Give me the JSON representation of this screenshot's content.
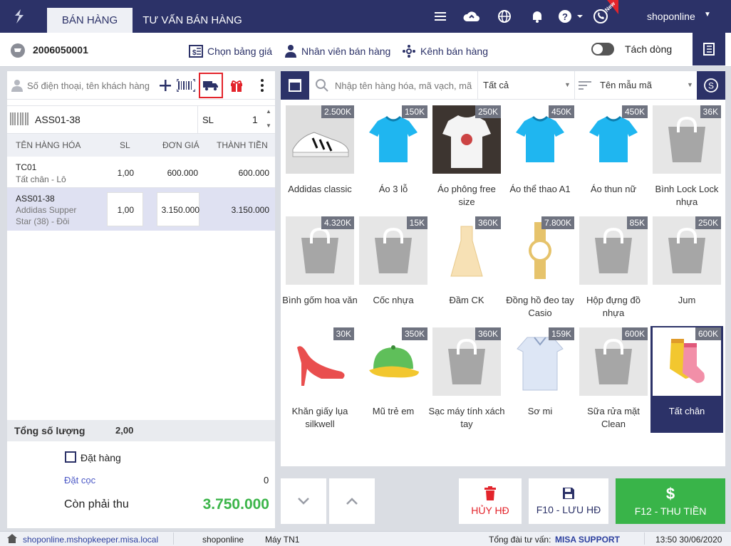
{
  "tabs": {
    "sales": "BÁN HÀNG",
    "consult": "TƯ VẤN BÁN HÀNG"
  },
  "topbar": {
    "user": "shoponline",
    "new_badge": "New"
  },
  "header": {
    "invoice_no": "2006050001",
    "price_list": "Chọn bảng giá",
    "staff": "Nhân viên bán hàng",
    "channel": "Kênh bán hàng",
    "split_line": "Tách dòng"
  },
  "customer": {
    "placeholder": "Số điện thoại, tên khách hàng"
  },
  "sku_input": {
    "value": "ASS01-38",
    "qty_label": "SL",
    "qty_value": "1"
  },
  "table": {
    "headers": {
      "name": "TÊN HÀNG HÓA",
      "qty": "SL",
      "price": "ĐƠN GIÁ",
      "total": "THÀNH TIỀN"
    },
    "rows": [
      {
        "code": "TC01",
        "desc": "Tất chân - Lô",
        "qty": "1,00",
        "price": "600.000",
        "total": "600.000"
      },
      {
        "code": "ASS01-38",
        "desc1": "Addidas Supper",
        "desc2": "Star (38) - Đôi",
        "qty": "1,00",
        "price": "3.150.000",
        "total": "3.150.000"
      }
    ]
  },
  "totals": {
    "label": "Tổng số lượng",
    "value": "2,00"
  },
  "summary": {
    "order_label": "Đặt hàng",
    "deposit_label": "Đặt cọc",
    "deposit_value": "0",
    "remaining_label": "Còn phải thu",
    "remaining_value": "3.750.000"
  },
  "search": {
    "placeholder": "Nhập tên hàng hóa, mã vạch, mã",
    "filter": "Tất cả",
    "template": "Tên mẫu mã"
  },
  "products": [
    {
      "name": "Addidas classic",
      "price": "2.500K",
      "img": "shoe"
    },
    {
      "name": "Áo 3 lỗ",
      "price": "150K",
      "img": "shirt"
    },
    {
      "name": "Áo phông free size",
      "price": "250K",
      "img": "tee"
    },
    {
      "name": "Áo thể thao A1",
      "price": "450K",
      "img": "shirt"
    },
    {
      "name": "Áo thun nữ",
      "price": "450K",
      "img": "shirt"
    },
    {
      "name": "Bình Lock Lock nhựa",
      "price": "36K",
      "img": "bag"
    },
    {
      "name": "Bình gốm hoa văn",
      "price": "4.320K",
      "img": "bag"
    },
    {
      "name": "Cốc nhựa",
      "price": "15K",
      "img": "bag"
    },
    {
      "name": "Đầm CK",
      "price": "360K",
      "img": "dress"
    },
    {
      "name": "Đồng hồ đeo tay Casio",
      "price": "7.800K",
      "img": "watch"
    },
    {
      "name": "Hộp đựng đồ nhựa",
      "price": "85K",
      "img": "bag"
    },
    {
      "name": "Jum",
      "price": "250K",
      "img": "bag"
    },
    {
      "name": "Khăn giấy lụa silkwell",
      "price": "30K",
      "img": "heel"
    },
    {
      "name": "Mũ trẻ em",
      "price": "350K",
      "img": "cap"
    },
    {
      "name": "Sạc máy tính xách tay",
      "price": "360K",
      "img": "bag"
    },
    {
      "name": "Sơ mi",
      "price": "159K",
      "img": "formal"
    },
    {
      "name": "Sữa rửa mặt Clean",
      "price": "600K",
      "img": "bag"
    },
    {
      "name": "Tất chân",
      "price": "600K",
      "img": "socks"
    }
  ],
  "actions": {
    "cancel": "HỦY HĐ",
    "save": "F10 - LƯU HĐ",
    "pay": "F12 - THU TIỀN"
  },
  "status": {
    "url": "shoponline.mshopkeeper.misa.local",
    "user": "shoponline",
    "machine": "Máy TN1",
    "hotline_label": "Tổng đài tư vấn:",
    "hotline": "MISA SUPPORT",
    "datetime": "13:50 30/06/2020"
  },
  "colors": {
    "navy": "#2c3268",
    "green": "#3cb54a",
    "pay_button": "#39b449",
    "red": "#e3242b",
    "selected_row": "#dfe1f2"
  }
}
